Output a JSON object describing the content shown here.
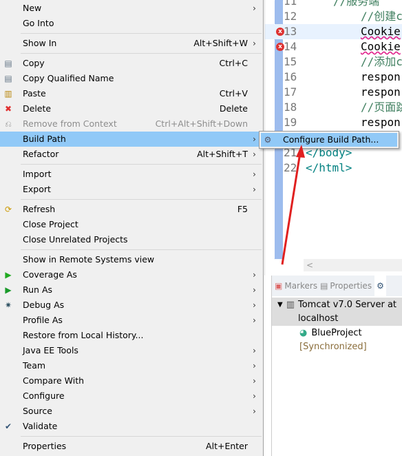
{
  "menu": {
    "items": [
      {
        "label": "New",
        "arrow": true
      },
      {
        "label": "Go Into"
      },
      {
        "sep": true
      },
      {
        "label": "Show In",
        "shortcut": "Alt+Shift+W",
        "arrow": true
      },
      {
        "sep": true
      },
      {
        "label": "Copy",
        "shortcut": "Ctrl+C",
        "icon": "copy-icon"
      },
      {
        "label": "Copy Qualified Name",
        "icon": "copy-qualified-name-icon"
      },
      {
        "label": "Paste",
        "shortcut": "Ctrl+V",
        "icon": "paste-icon"
      },
      {
        "label": "Delete",
        "shortcut": "Delete",
        "icon": "delete-icon"
      },
      {
        "label": "Remove from Context",
        "shortcut": "Ctrl+Alt+Shift+Down",
        "icon": "remove-context-icon",
        "disabled": true
      },
      {
        "label": "Build Path",
        "arrow": true,
        "selected": true
      },
      {
        "label": "Refactor",
        "shortcut": "Alt+Shift+T",
        "arrow": true
      },
      {
        "sep": true
      },
      {
        "label": "Import",
        "arrow": true
      },
      {
        "label": "Export",
        "arrow": true
      },
      {
        "sep": true
      },
      {
        "label": "Refresh",
        "shortcut": "F5",
        "icon": "refresh-icon"
      },
      {
        "label": "Close Project"
      },
      {
        "label": "Close Unrelated Projects"
      },
      {
        "sep": true
      },
      {
        "label": "Show in Remote Systems view"
      },
      {
        "label": "Coverage As",
        "arrow": true,
        "icon": "coverage-icon"
      },
      {
        "label": "Run As",
        "arrow": true,
        "icon": "run-icon"
      },
      {
        "label": "Debug As",
        "arrow": true,
        "icon": "debug-icon"
      },
      {
        "label": "Profile As",
        "arrow": true
      },
      {
        "label": "Restore from Local History..."
      },
      {
        "label": "Java EE Tools",
        "arrow": true
      },
      {
        "label": "Team",
        "arrow": true
      },
      {
        "label": "Compare With",
        "arrow": true
      },
      {
        "label": "Configure",
        "arrow": true
      },
      {
        "label": "Source",
        "arrow": true
      },
      {
        "label": "Validate",
        "icon": "check-icon"
      },
      {
        "sep": true
      },
      {
        "label": "Properties",
        "shortcut": "Alt+Enter"
      }
    ]
  },
  "submenu": {
    "label": "Configure Build Path..."
  },
  "editor": {
    "lines": [
      {
        "n": "11",
        "text": "//服务端",
        "cls": "cm",
        "indent": 1
      },
      {
        "n": "12",
        "text": "//创建c",
        "cls": "cm",
        "indent": 2
      },
      {
        "n": "13",
        "text": "Cookie",
        "indent": 2,
        "error": true,
        "current": true
      },
      {
        "n": "14",
        "text": "Cookie",
        "indent": 2,
        "error": true
      },
      {
        "n": "15",
        "text": "//添加c",
        "cls": "cm",
        "indent": 2
      },
      {
        "n": "16",
        "text": "respon",
        "indent": 2
      },
      {
        "n": "17",
        "text": "respon",
        "indent": 2
      },
      {
        "n": "18",
        "text": "//页面跳",
        "cls": "cm",
        "indent": 2
      },
      {
        "n": "19",
        "text": "respon",
        "indent": 2
      },
      {
        "n": "20",
        "text": "",
        "indent": 0
      },
      {
        "n": "21",
        "text": "</body>",
        "cls": "tag",
        "indent": 0
      },
      {
        "n": "22",
        "text": "</html>",
        "cls": "tag",
        "indent": 0
      }
    ],
    "scroll_left": "<"
  },
  "panel": {
    "tabs": [
      "Markers",
      "Properties"
    ],
    "server": "Tomcat v7.0 Server at localhost",
    "project": "BlueProject",
    "project_status": "[Synchronized]"
  },
  "colors": {
    "selection": "#91c9f7",
    "menu_bg": "#f0f0f0",
    "annotation_arrow": "#e02020"
  }
}
